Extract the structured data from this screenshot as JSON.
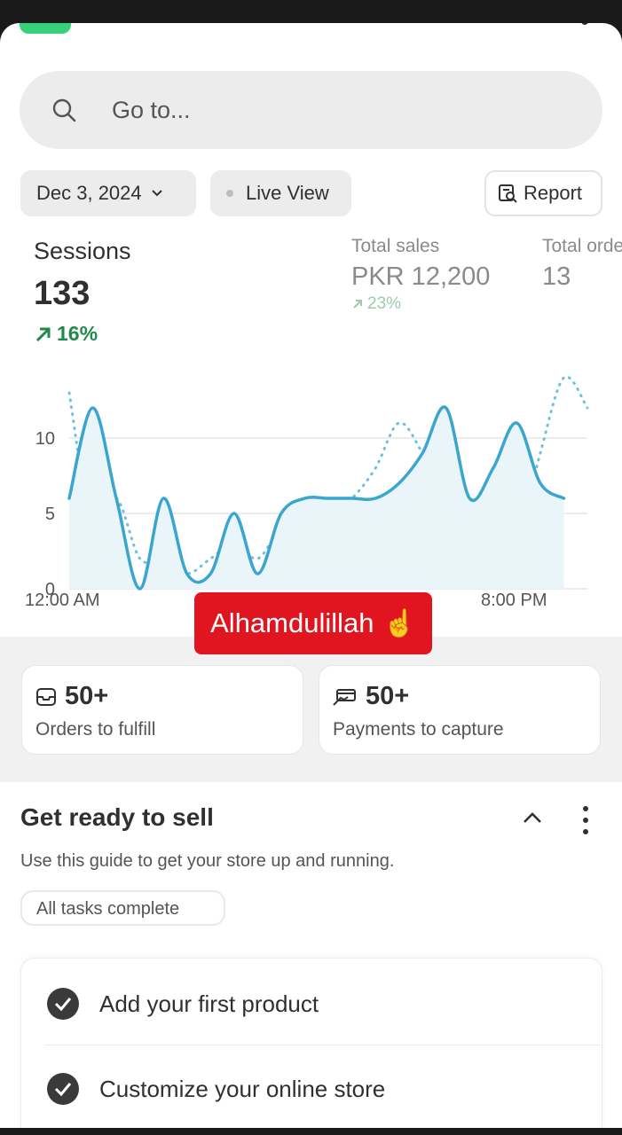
{
  "search": {
    "placeholder": "Go to..."
  },
  "filters": {
    "date_label": "Dec 3, 2024",
    "live_label": "Live View",
    "report_label": "Report"
  },
  "metrics": [
    {
      "label": "Sessions",
      "value": "133",
      "change": "16%"
    },
    {
      "label": "Total sales",
      "value": "PKR 12,200",
      "change": "23%"
    },
    {
      "label": "Total orders",
      "value": "13"
    }
  ],
  "chart_data": {
    "type": "line",
    "y_ticks": [
      "10",
      "5",
      "0"
    ],
    "x_tick_labels": [
      "12:00 AM",
      "8:00 PM"
    ],
    "ylim": [
      0,
      14
    ],
    "grid": true,
    "x": [
      0,
      1,
      2,
      3,
      4,
      5,
      6,
      7,
      8,
      9,
      10,
      11,
      12,
      13,
      14,
      15,
      16,
      17,
      18,
      19,
      20,
      21,
      22
    ],
    "series": [
      {
        "style": "solid",
        "color": "#3aa6cf",
        "values": [
          6,
          12,
          6,
          0,
          6,
          1,
          1,
          5,
          1,
          5,
          6,
          6,
          6,
          6,
          7,
          9,
          12,
          6,
          8,
          11,
          7,
          6,
          null
        ]
      },
      {
        "style": "dotted",
        "color": "#6fc0dc",
        "values": [
          13,
          4,
          6,
          2,
          2,
          1,
          2,
          3,
          2,
          4,
          4,
          5,
          6,
          8,
          11,
          9,
          6,
          6,
          4,
          3,
          9,
          14,
          12
        ]
      }
    ]
  },
  "overlay": {
    "text": "Alhamdulillah",
    "emoji": "☝️"
  },
  "cards": [
    {
      "icon": "inbox-icon",
      "count": "50+",
      "label": "Orders to fulfill"
    },
    {
      "icon": "payment-icon",
      "count": "50+",
      "label": "Payments to capture"
    }
  ],
  "guide": {
    "title": "Get ready to sell",
    "description": "Use this guide to get your store up and running.",
    "status": "All tasks complete",
    "tasks": [
      {
        "label": "Add your first product"
      },
      {
        "label": "Customize your online store"
      }
    ]
  },
  "colors": {
    "positive": "#1f8a4c",
    "line": "#3aa6cf",
    "overlay": "#e0151f"
  }
}
